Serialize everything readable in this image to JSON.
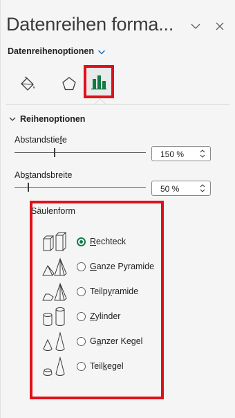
{
  "pane": {
    "title": "Datenreihen forma...",
    "subheader": "Datenreihenoptionen"
  },
  "section": {
    "title": "Reihenoptionen",
    "gap_depth": {
      "label_pre": "Abstandstie",
      "label_key": "f",
      "label_post": "e",
      "value": "150 %",
      "level": 0.3
    },
    "gap_width": {
      "label_pre": "Ab",
      "label_key": "s",
      "label_post": "tandsbreite",
      "value": "50 %",
      "level": 0.1
    }
  },
  "column_shape": {
    "title": "Säulenform",
    "options": [
      {
        "pre": "",
        "key": "R",
        "post": "echteck",
        "selected": true,
        "icon": "box-icon"
      },
      {
        "pre": "",
        "key": "G",
        "post": "anze Pyramide",
        "selected": false,
        "icon": "full-pyramid-icon"
      },
      {
        "pre": "Teilp",
        "key": "y",
        "post": "ramide",
        "selected": false,
        "icon": "partial-pyramid-icon"
      },
      {
        "pre": "",
        "key": "Z",
        "post": "ylinder",
        "selected": false,
        "icon": "cylinder-icon"
      },
      {
        "pre": "G",
        "key": "a",
        "post": "nzer Kegel",
        "selected": false,
        "icon": "full-cone-icon"
      },
      {
        "pre": "Teil",
        "key": "k",
        "post": "egel",
        "selected": false,
        "icon": "partial-cone-icon"
      }
    ]
  },
  "colors": {
    "highlight": "#e0101a",
    "accent": "#107c41",
    "link": "#0f6cbd"
  }
}
